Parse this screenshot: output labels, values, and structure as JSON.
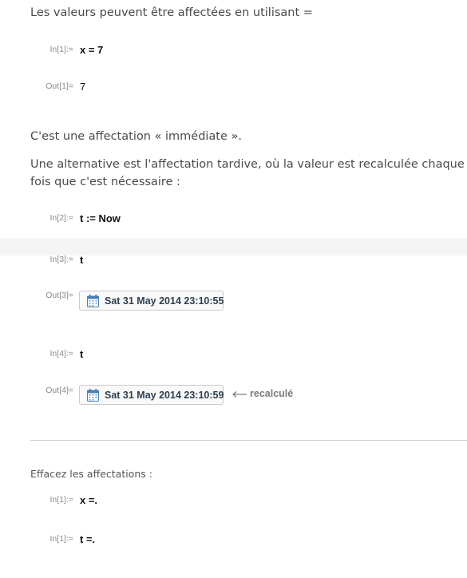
{
  "intro": {
    "assign_text": "Les valeurs peuvent être affectées en utilisant =",
    "immediate_text": "C'est une affectation « immédiate ».",
    "delayed_text_line1": "Une alternative est l'affectation tardive, où la valeur est recalculée chaque",
    "delayed_text_line2": "fois que c'est nécessaire :"
  },
  "cells": {
    "in1_label": "In[1]:=",
    "in1_code": "x = 7",
    "out1_label": "Out[1]=",
    "out1_value": "7",
    "in2_label": "In[2]:=",
    "in2_code": "t := Now",
    "in3_label": "In[3]:=",
    "in3_code": "t",
    "out3_label": "Out[3]=",
    "out3_date": "Sat 31 May 2014 23:10:55",
    "in4_label": "In[4]:=",
    "in4_code": "t",
    "out4_label": "Out[4]=",
    "out4_date": "Sat 31 May 2014 23:10:59",
    "annotation": "recalculé"
  },
  "clear": {
    "heading": "Effacez les affectations :",
    "in1_label": "In[1]:=",
    "in1_code": "x =.",
    "in2_label": "In[1]:=",
    "in2_code": "t =."
  },
  "icons": {
    "calendar": "calendar-icon",
    "arrow": "left-arrow-icon"
  },
  "colors": {
    "date_text": "#2e3f4f",
    "calendar_icon": "#4a7fb5",
    "label": "#8a8a8a"
  }
}
